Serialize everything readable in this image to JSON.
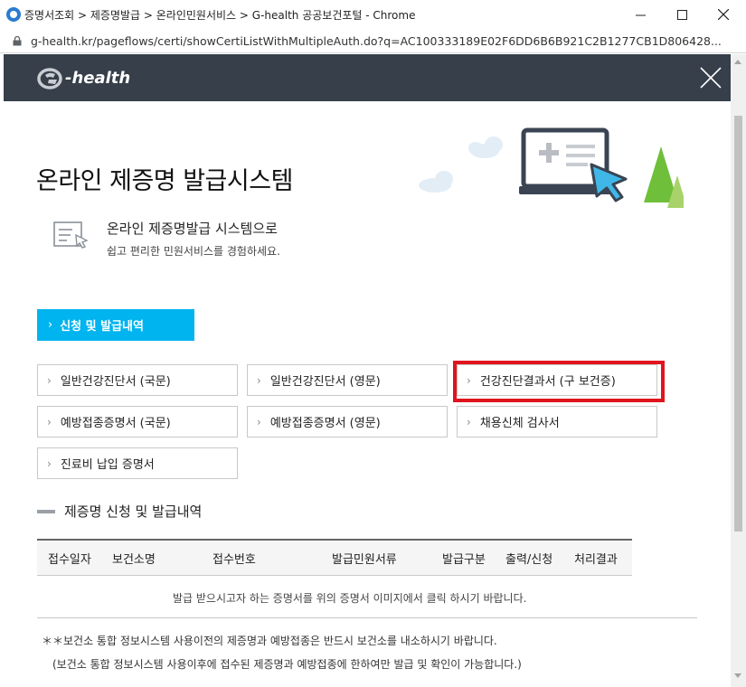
{
  "window": {
    "title": "증명서조회 > 제증명발급 > 온라인민원서비스 > G-health 공공보건포털 - Chrome",
    "url": "g-health.kr/pageflows/certi/showCertiListWithMultipleAuth.do?q=AC100333189E02F6DD6B6B921C2B1277CB1D806428..."
  },
  "header": {
    "logo_text": "-health"
  },
  "page": {
    "title": "온라인 제증명 발급시스템",
    "intro_line1": "온라인 제증명발급 시스템으로",
    "intro_line2": "쉽고 편리한 민원서비스를 경험하세요."
  },
  "tab": {
    "label": "신청 및 발급내역"
  },
  "certificates": [
    {
      "label": "일반건강진단서 (국문)"
    },
    {
      "label": "일반건강진단서 (영문)"
    },
    {
      "label": "건강진단결과서 (구 보건증)"
    },
    {
      "label": "예방접종증명서 (국문)"
    },
    {
      "label": "예방접종증명서 (영문)"
    },
    {
      "label": "채용신체 검사서"
    },
    {
      "label": "진료비 납입 증명서"
    }
  ],
  "history": {
    "title": "제증명 신청 및 발급내역",
    "columns": [
      "접수일자",
      "보건소명",
      "접수번호",
      "발급민원서류",
      "발급구분",
      "출력/신청",
      "처리결과"
    ],
    "empty_message": "발급 받으시고자 하는 증명서를 위의 증명서 이미지에서 클릭 하시기 바랍니다."
  },
  "notes": {
    "line1": "＊＊보건소 통합 정보시스템 사용이전의 제증명과 예방접종은 반드시 보건소를 내소하시기 바랍니다.",
    "line2": "(보건소 통합 정보시스템 사용이후에 접수된 제증명과 예방접종에 한하여만 발급 및 확인이 가능합니다.)"
  },
  "colors": {
    "header_bg": "#363f4a",
    "accent": "#00b4ef",
    "highlight": "#e0141e"
  }
}
